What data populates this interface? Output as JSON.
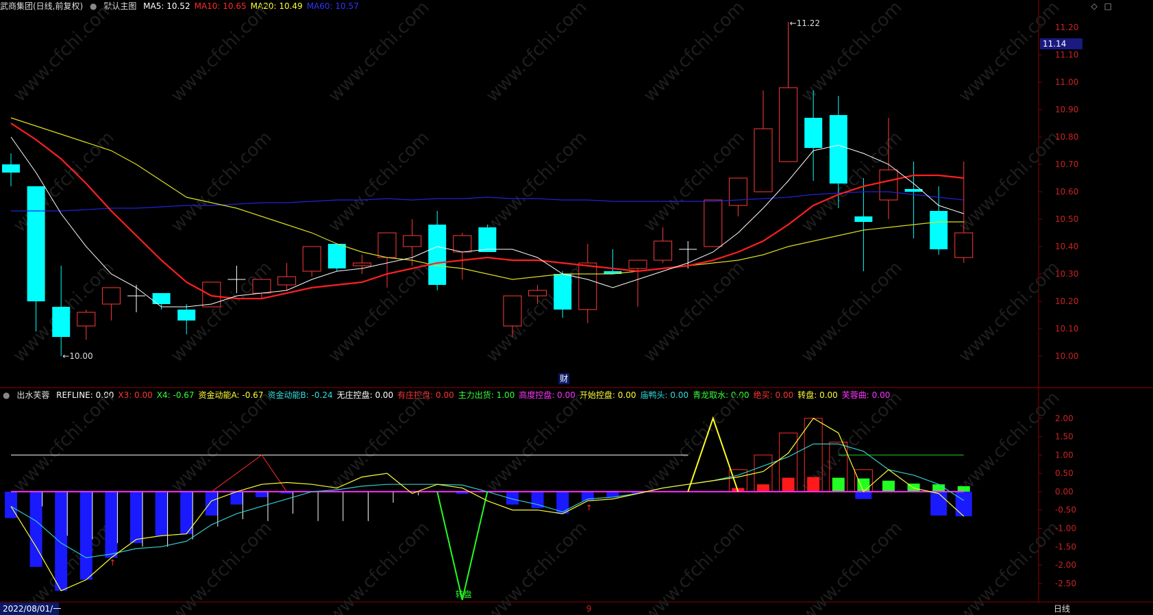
{
  "header": {
    "stock_title": "武商集团(日线,前复权)",
    "main_chart_label": "默认主图",
    "ma": [
      {
        "text": "MA5: 10.52",
        "color": "#ffffff"
      },
      {
        "text": "MA10: 10.65",
        "color": "#ff2a2a"
      },
      {
        "text": "MA20: 10.49",
        "color": "#ffff33"
      },
      {
        "text": "MA60: 10.57",
        "color": "#3333ff"
      }
    ],
    "current_price": "11.14"
  },
  "indicator_header": {
    "name": "出水芙蓉",
    "items": [
      {
        "text": "REFLINE: 0.00",
        "color": "#ffffff"
      },
      {
        "text": "X3: 0.00",
        "color": "#ff3333"
      },
      {
        "text": "X4: -0.67",
        "color": "#33ff33"
      },
      {
        "text": "资金动能A: -0.67",
        "color": "#ffff33"
      },
      {
        "text": "资金动能B: -0.24",
        "color": "#33dddd"
      },
      {
        "text": "无庄控盘: 0.00",
        "color": "#ffffff"
      },
      {
        "text": "有庄控盘: 0.00",
        "color": "#ff3333"
      },
      {
        "text": "主力出货: 1.00",
        "color": "#33ff33"
      },
      {
        "text": "高度控盘: 0.00",
        "color": "#ff33ff"
      },
      {
        "text": "开始控盘: 0.00",
        "color": "#ffff33"
      },
      {
        "text": "庙鸭头: 0.00",
        "color": "#33dddd"
      },
      {
        "text": "青龙取水: 0.00",
        "color": "#33ff33"
      },
      {
        "text": "绝买: 0.00",
        "color": "#ff3333"
      },
      {
        "text": "转盘: 0.00",
        "color": "#ffff33"
      },
      {
        "text": "芙蓉曲: 0.00",
        "color": "#ff33ff"
      }
    ]
  },
  "footer": {
    "date_label": "2022/08/01/一",
    "mid_label": "9",
    "period_label": "日线"
  },
  "annotations": {
    "high": "11.22",
    "low": "10.00",
    "fin_tag": "财",
    "turn_label": "转盘"
  },
  "watermark": "www.cfchi.com",
  "chart_data": [
    {
      "type": "candlestick",
      "ylim": [
        9.95,
        11.25
      ],
      "yticks": [
        10.0,
        10.1,
        10.2,
        10.3,
        10.4,
        10.5,
        10.6,
        10.7,
        10.8,
        10.9,
        11.0,
        11.1,
        11.2
      ],
      "candles": [
        [
          10.7,
          10.74,
          10.62,
          10.67
        ],
        [
          10.62,
          10.62,
          10.09,
          10.2
        ],
        [
          10.18,
          10.33,
          10.0,
          10.07
        ],
        [
          10.11,
          10.17,
          10.06,
          10.16
        ],
        [
          10.19,
          10.25,
          10.13,
          10.25
        ],
        [
          10.22,
          10.26,
          10.16,
          10.22
        ],
        [
          10.23,
          10.23,
          10.17,
          10.19
        ],
        [
          10.17,
          10.19,
          10.08,
          10.13
        ],
        [
          10.18,
          10.27,
          10.18,
          10.27
        ],
        [
          10.28,
          10.33,
          10.23,
          10.28
        ],
        [
          10.23,
          10.28,
          10.21,
          10.28
        ],
        [
          10.26,
          10.34,
          10.24,
          10.29
        ],
        [
          10.31,
          10.4,
          10.29,
          10.4
        ],
        [
          10.41,
          10.41,
          10.31,
          10.32
        ],
        [
          10.33,
          10.37,
          10.3,
          10.34
        ],
        [
          10.36,
          10.45,
          10.25,
          10.45
        ],
        [
          10.4,
          10.5,
          10.33,
          10.44
        ],
        [
          10.48,
          10.53,
          10.24,
          10.26
        ],
        [
          10.38,
          10.45,
          10.28,
          10.44
        ],
        [
          10.47,
          10.48,
          10.38,
          10.38
        ],
        [
          10.11,
          10.22,
          10.07,
          10.22
        ],
        [
          10.22,
          10.26,
          10.19,
          10.24
        ],
        [
          10.3,
          10.31,
          10.14,
          10.17
        ],
        [
          10.17,
          10.41,
          10.12,
          10.34
        ],
        [
          10.31,
          10.39,
          10.3,
          10.3
        ],
        [
          10.32,
          10.35,
          10.18,
          10.35
        ],
        [
          10.35,
          10.47,
          10.34,
          10.42
        ],
        [
          10.39,
          10.42,
          10.32,
          10.39
        ],
        [
          10.4,
          10.57,
          10.4,
          10.57
        ],
        [
          10.55,
          10.65,
          10.51,
          10.65
        ],
        [
          10.6,
          10.97,
          10.6,
          10.83
        ],
        [
          10.71,
          11.22,
          10.71,
          10.98
        ],
        [
          10.87,
          10.97,
          10.64,
          10.76
        ],
        [
          10.88,
          10.95,
          10.54,
          10.63
        ],
        [
          10.51,
          10.65,
          10.31,
          10.49
        ],
        [
          10.57,
          10.87,
          10.5,
          10.68
        ],
        [
          10.61,
          10.71,
          10.43,
          10.6
        ],
        [
          10.53,
          10.62,
          10.37,
          10.39
        ],
        [
          10.36,
          10.71,
          10.34,
          10.45
        ]
      ],
      "ma5": [
        10.8,
        10.67,
        10.52,
        10.4,
        10.3,
        10.25,
        10.18,
        10.18,
        10.19,
        10.22,
        10.23,
        10.24,
        10.28,
        10.31,
        10.32,
        10.34,
        10.36,
        10.4,
        10.38,
        10.39,
        10.39,
        10.36,
        10.3,
        10.28,
        10.25,
        10.28,
        10.31,
        10.34,
        10.38,
        10.45,
        10.54,
        10.64,
        10.75,
        10.77,
        10.74,
        10.7,
        10.63,
        10.55,
        10.52
      ],
      "ma10": [
        10.85,
        10.79,
        10.72,
        10.63,
        10.53,
        10.44,
        10.35,
        10.27,
        10.22,
        10.21,
        10.21,
        10.23,
        10.25,
        10.26,
        10.27,
        10.3,
        10.32,
        10.34,
        10.35,
        10.36,
        10.35,
        10.35,
        10.34,
        10.33,
        10.32,
        10.31,
        10.32,
        10.33,
        10.35,
        10.38,
        10.42,
        10.48,
        10.55,
        10.59,
        10.62,
        10.64,
        10.66,
        10.66,
        10.65
      ],
      "ma20": [
        10.87,
        10.84,
        10.81,
        10.78,
        10.75,
        10.7,
        10.64,
        10.58,
        10.56,
        10.54,
        10.51,
        10.48,
        10.45,
        10.41,
        10.38,
        10.36,
        10.35,
        10.33,
        10.32,
        10.3,
        10.28,
        10.29,
        10.3,
        10.3,
        10.3,
        10.31,
        10.32,
        10.33,
        10.34,
        10.35,
        10.37,
        10.4,
        10.42,
        10.44,
        10.46,
        10.47,
        10.48,
        10.49,
        10.49
      ],
      "ma60": [
        10.53,
        10.53,
        10.53,
        10.535,
        10.54,
        10.54,
        10.545,
        10.55,
        10.55,
        10.555,
        10.56,
        10.56,
        10.565,
        10.57,
        10.57,
        10.575,
        10.57,
        10.575,
        10.575,
        10.58,
        10.575,
        10.575,
        10.57,
        10.57,
        10.565,
        10.565,
        10.565,
        10.565,
        10.565,
        10.57,
        10.575,
        10.58,
        10.59,
        10.595,
        10.6,
        10.6,
        10.59,
        10.58,
        10.57
      ]
    },
    {
      "type": "bar+line",
      "ylim": [
        -2.95,
        2.35
      ],
      "yticks": [
        2.0,
        1.5,
        1.0,
        0.5,
        0.0,
        -0.5,
        -1.0,
        -1.5,
        -2.0,
        -2.5
      ],
      "bars": [
        -0.72,
        -2.05,
        -2.7,
        -2.4,
        -1.8,
        -1.4,
        -1.2,
        -1.15,
        -0.65,
        -0.35,
        -0.15,
        -0.05,
        0.0,
        0.0,
        0.0,
        0.0,
        0.0,
        0.0,
        -0.06,
        0.0,
        -0.35,
        -0.45,
        -0.6,
        -0.25,
        -0.15,
        -0.05,
        0.0,
        0.0,
        0.0,
        0.1,
        0.2,
        0.38,
        0.4,
        0.38,
        0.36,
        0.3,
        0.22,
        0.2,
        0.15
      ],
      "bar_colors": [
        "#1a1aff",
        "#1a1aff",
        "#1a1aff",
        "#1a1aff",
        "#1a1aff",
        "#1a1aff",
        "#1a1aff",
        "#1a1aff",
        "#1a1aff",
        "#1a1aff",
        "#1a1aff",
        "#1a1aff",
        "#1a1aff",
        "#1a1aff",
        "#1a1aff",
        "#1a1aff",
        "#1a1aff",
        "#1a1aff",
        "#1a1aff",
        "#1a1aff",
        "#1a1aff",
        "#1a1aff",
        "#1a1aff",
        "#1a1aff",
        "#1a1aff",
        "#1a1aff",
        "#1a1aff",
        "#1a1aff",
        "#ff1a1a",
        "#ff1a1a",
        "#ff1a1a",
        "#ff1a1a",
        "#ff1a1a",
        "#22ff22",
        "#22ff22",
        "#22ff22",
        "#22ff22",
        "#22ff22",
        "#22ff22"
      ],
      "dev_bars": [
        0,
        0,
        0,
        0,
        0,
        0,
        0,
        0,
        0,
        0,
        0,
        0,
        0,
        0,
        0,
        0,
        0,
        0,
        0,
        0,
        0,
        0,
        0,
        0,
        0,
        0,
        0,
        0,
        0,
        0,
        0,
        0,
        0,
        0,
        -0.2,
        0,
        0,
        -0.65,
        -0.67
      ],
      "white_spikes": [
        0,
        -0.4,
        -1.2,
        -1.3,
        -1.4,
        -1.5,
        -1.5,
        -1.3,
        -0.95,
        -0.75,
        -0.8,
        -0.6,
        -0.8,
        -0.8,
        -0.8,
        -0.3,
        -0.1,
        0,
        0,
        0,
        0,
        0,
        0,
        0,
        0,
        0,
        0,
        0,
        0,
        0,
        0,
        0,
        0,
        0,
        0,
        0,
        0,
        0,
        0
      ],
      "a_line": [
        -0.4,
        -1.5,
        -2.7,
        -2.4,
        -1.8,
        -1.3,
        -1.2,
        -1.15,
        -0.25,
        0.0,
        0.2,
        0.25,
        0.2,
        0.1,
        0.4,
        0.5,
        -0.05,
        0.2,
        0.1,
        -0.25,
        -0.5,
        -0.5,
        -0.6,
        -0.25,
        -0.2,
        -0.05,
        0.1,
        0.2,
        0.3,
        0.4,
        0.55,
        1.05,
        2.0,
        1.6,
        0.0,
        0.6,
        0.1,
        -0.05,
        -0.67
      ],
      "b_line": [
        -0.4,
        -0.8,
        -1.4,
        -1.8,
        -1.7,
        -1.55,
        -1.5,
        -1.35,
        -0.9,
        -0.6,
        -0.4,
        -0.2,
        0.0,
        0.05,
        0.15,
        0.2,
        0.2,
        0.2,
        0.18,
        0.0,
        -0.2,
        -0.35,
        -0.55,
        -0.2,
        -0.15,
        -0.05,
        0.1,
        0.2,
        0.3,
        0.45,
        0.7,
        0.95,
        1.3,
        1.3,
        1.1,
        0.6,
        0.45,
        0.2,
        -0.24
      ],
      "refline_upper": 1.0,
      "green_line_level": 1.0
    }
  ]
}
